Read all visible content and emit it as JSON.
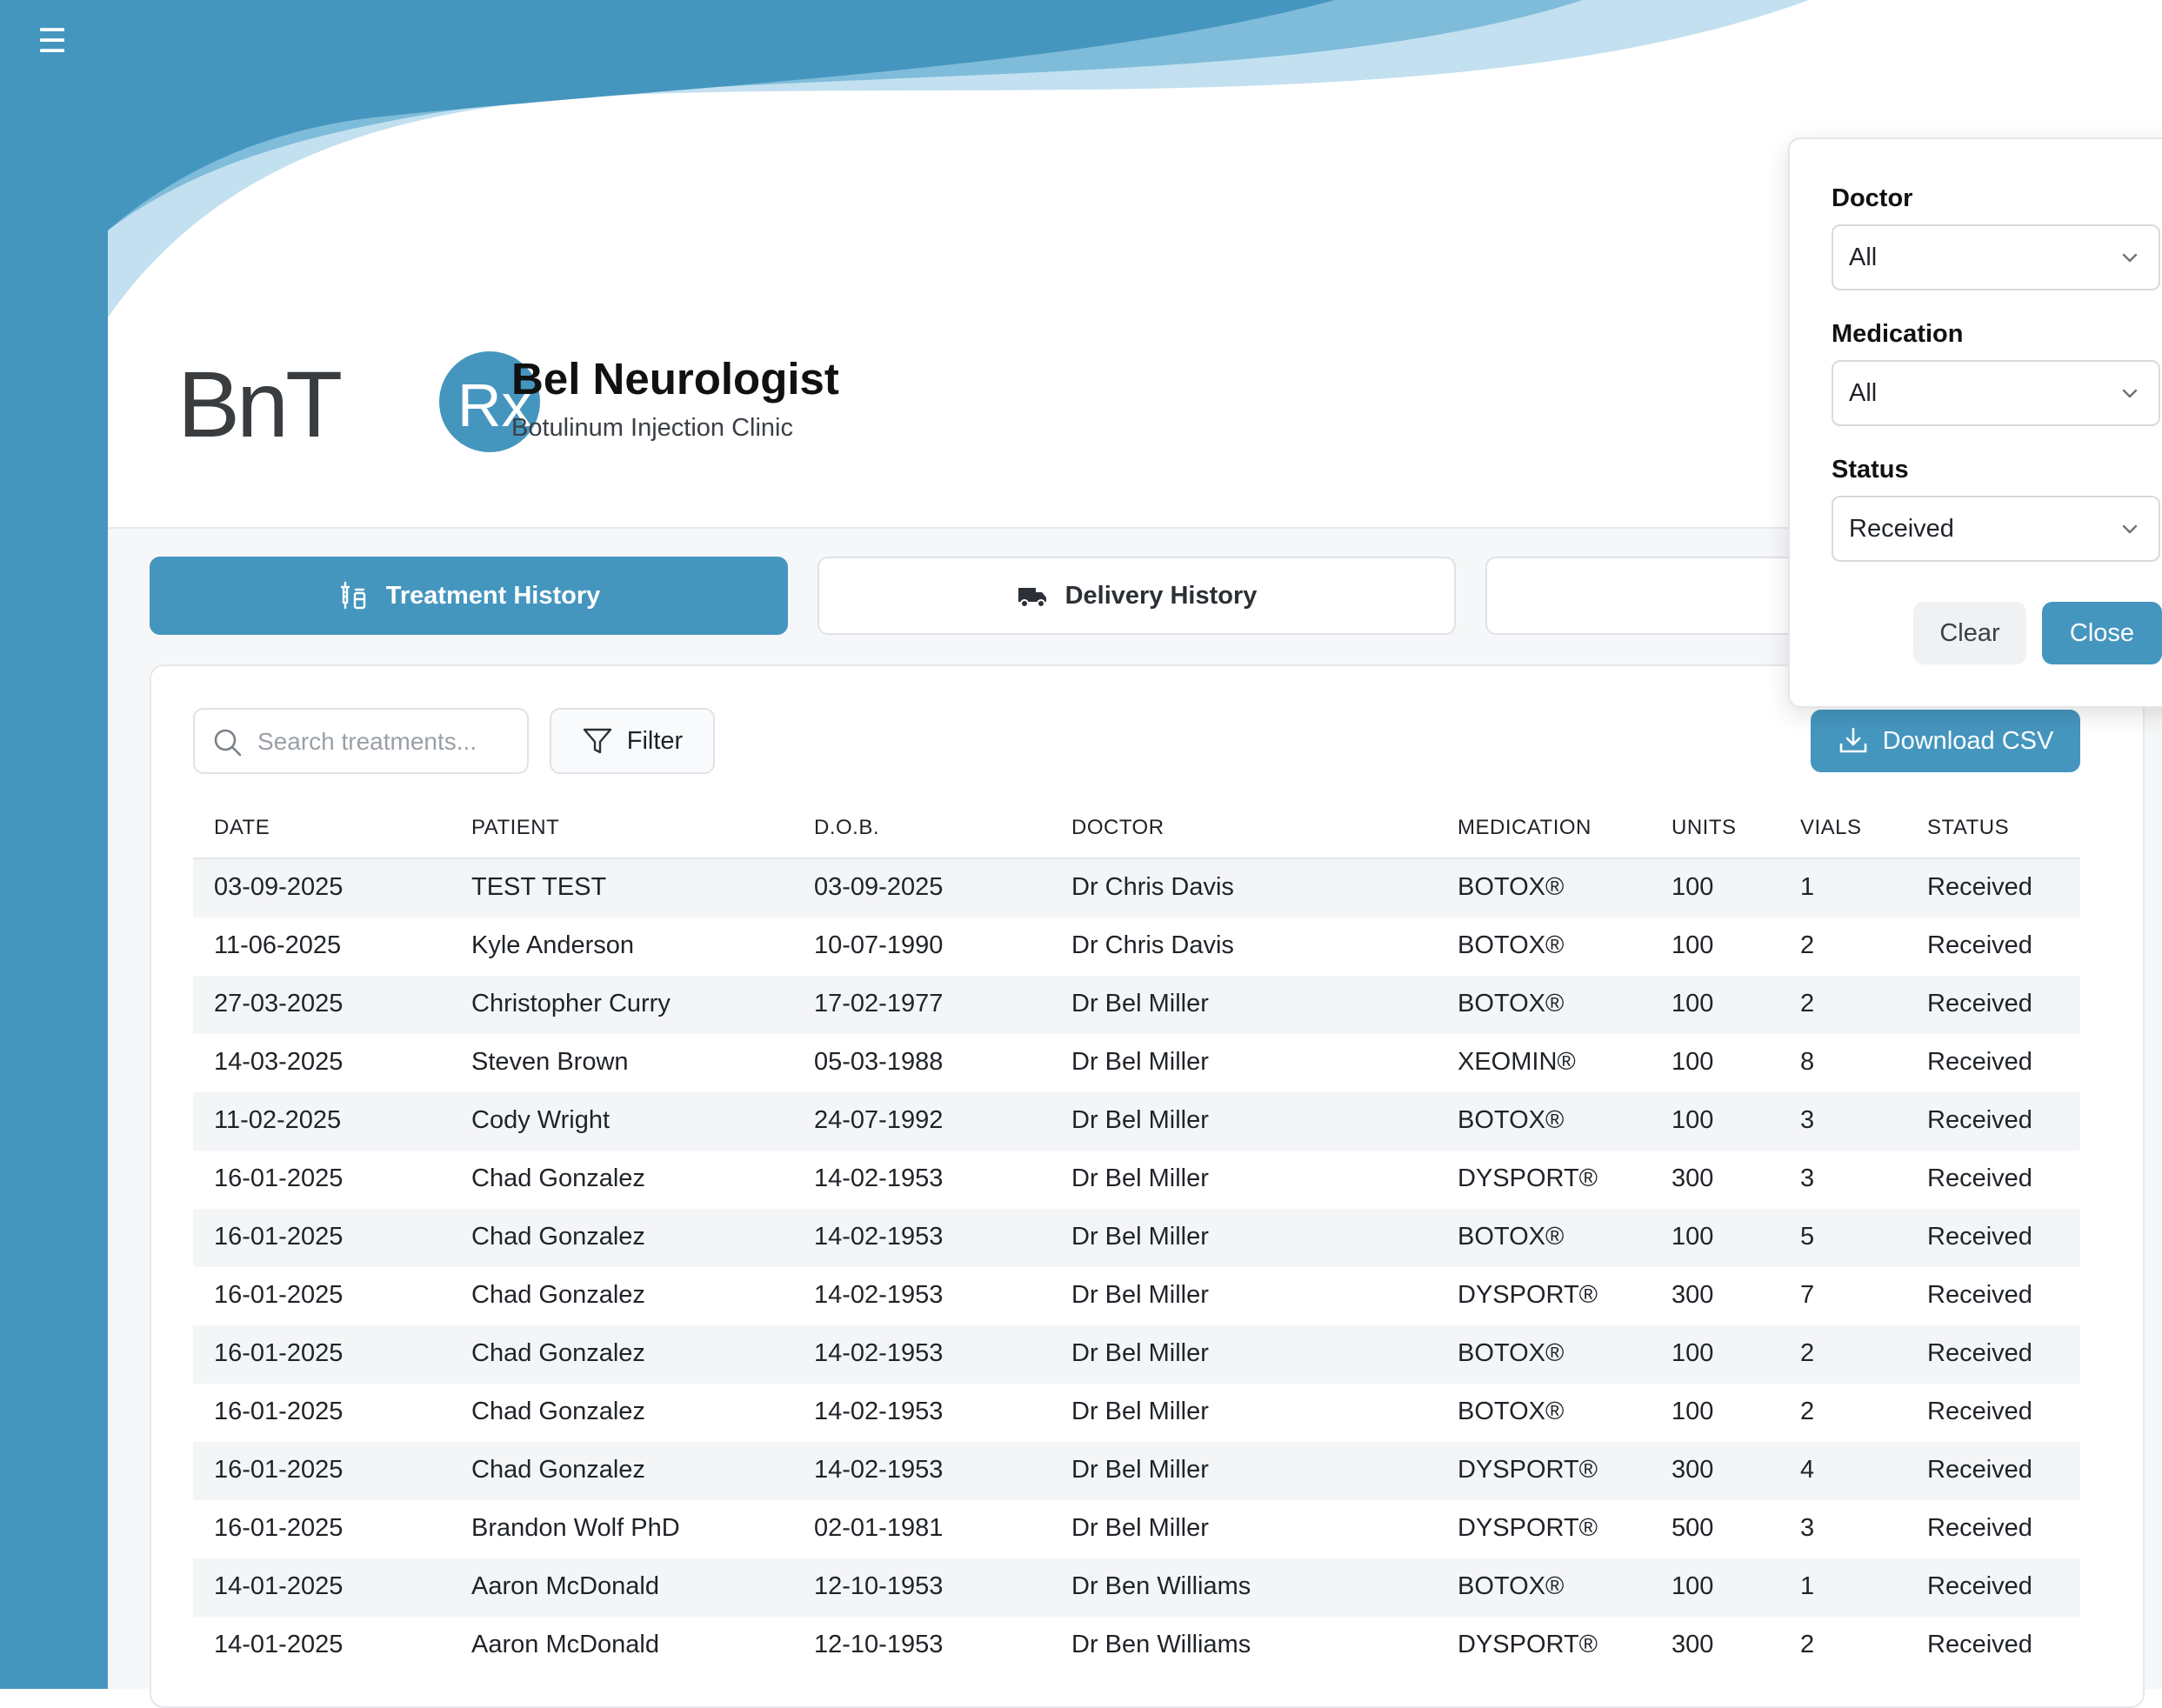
{
  "header": {
    "logo_text": "BnT",
    "logo_badge": "Rx",
    "clinic_name": "Bel Neurologist",
    "clinic_subtitle": "Botulinum Injection Clinic"
  },
  "tabs": [
    {
      "label": "Treatment History",
      "icon": "syringe-vial-icon",
      "active": true
    },
    {
      "label": "Delivery History",
      "icon": "truck-icon",
      "active": false
    },
    {
      "label": "",
      "icon": "",
      "active": false
    }
  ],
  "toolbar": {
    "search_placeholder": "Search treatments...",
    "filter_label": "Filter",
    "download_label": "Download CSV"
  },
  "filter_popover": {
    "doctor_label": "Doctor",
    "doctor_value": "All",
    "medication_label": "Medication",
    "medication_value": "All",
    "status_label": "Status",
    "status_value": "Received",
    "clear_label": "Clear",
    "close_label": "Close"
  },
  "table": {
    "columns": [
      "DATE",
      "PATIENT",
      "D.O.B.",
      "DOCTOR",
      "MEDICATION",
      "UNITS",
      "VIALS",
      "STATUS"
    ],
    "rows": [
      [
        "03-09-2025",
        "TEST TEST",
        "03-09-2025",
        "Dr Chris Davis",
        "BOTOX®",
        "100",
        "1",
        "Received"
      ],
      [
        "11-06-2025",
        "Kyle Anderson",
        "10-07-1990",
        "Dr Chris Davis",
        "BOTOX®",
        "100",
        "2",
        "Received"
      ],
      [
        "27-03-2025",
        "Christopher Curry",
        "17-02-1977",
        "Dr Bel Miller",
        "BOTOX®",
        "100",
        "2",
        "Received"
      ],
      [
        "14-03-2025",
        "Steven Brown",
        "05-03-1988",
        "Dr Bel Miller",
        "XEOMIN®",
        "100",
        "8",
        "Received"
      ],
      [
        "11-02-2025",
        "Cody Wright",
        "24-07-1992",
        "Dr Bel Miller",
        "BOTOX®",
        "100",
        "3",
        "Received"
      ],
      [
        "16-01-2025",
        "Chad Gonzalez",
        "14-02-1953",
        "Dr Bel Miller",
        "DYSPORT®",
        "300",
        "3",
        "Received"
      ],
      [
        "16-01-2025",
        "Chad Gonzalez",
        "14-02-1953",
        "Dr Bel Miller",
        "BOTOX®",
        "100",
        "5",
        "Received"
      ],
      [
        "16-01-2025",
        "Chad Gonzalez",
        "14-02-1953",
        "Dr Bel Miller",
        "DYSPORT®",
        "300",
        "7",
        "Received"
      ],
      [
        "16-01-2025",
        "Chad Gonzalez",
        "14-02-1953",
        "Dr Bel Miller",
        "BOTOX®",
        "100",
        "2",
        "Received"
      ],
      [
        "16-01-2025",
        "Chad Gonzalez",
        "14-02-1953",
        "Dr Bel Miller",
        "BOTOX®",
        "100",
        "2",
        "Received"
      ],
      [
        "16-01-2025",
        "Chad Gonzalez",
        "14-02-1953",
        "Dr Bel Miller",
        "DYSPORT®",
        "300",
        "4",
        "Received"
      ],
      [
        "16-01-2025",
        "Brandon Wolf PhD",
        "02-01-1981",
        "Dr Bel Miller",
        "DYSPORT®",
        "500",
        "3",
        "Received"
      ],
      [
        "14-01-2025",
        "Aaron McDonald",
        "12-10-1953",
        "Dr Ben Williams",
        "BOTOX®",
        "100",
        "1",
        "Received"
      ],
      [
        "14-01-2025",
        "Aaron McDonald",
        "12-10-1953",
        "Dr Ben Williams",
        "DYSPORT®",
        "300",
        "2",
        "Received"
      ]
    ]
  },
  "colors": {
    "accent": "#4596bf",
    "wave_light": "#c2e0f0"
  }
}
